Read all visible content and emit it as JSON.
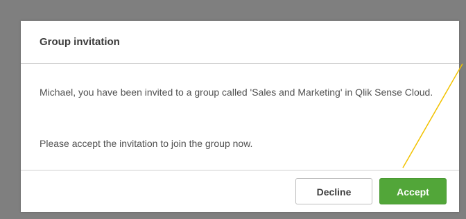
{
  "dialog": {
    "title": "Group invitation",
    "message": "Michael, you have been invited to a group called 'Sales and Marketing' in Qlik Sense Cloud.",
    "prompt": "Please accept the invitation to join the group now.",
    "decline_label": "Decline",
    "accept_label": "Accept"
  },
  "colors": {
    "overlay": "#7f7f7f",
    "accept_button": "#52a639",
    "annotation_line": "#f2c200"
  }
}
